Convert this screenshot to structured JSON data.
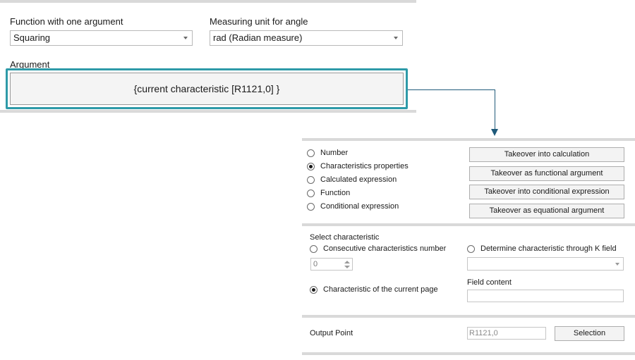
{
  "function_panel": {
    "function_label": "Function with one argument",
    "function_value": "Squaring",
    "angle_unit_label": "Measuring unit for angle",
    "angle_unit_value": "rad (Radian measure)",
    "argument_label": "Argument",
    "argument_value": "{current characteristic [R1121,0] }"
  },
  "colors": {
    "highlight_border": "#2e9aa8",
    "connector_arrow": "#1f5a7a"
  },
  "selector": {
    "options": [
      {
        "label": "Number",
        "selected": false
      },
      {
        "label": "Characteristics properties",
        "selected": true
      },
      {
        "label": "Calculated expression",
        "selected": false
      },
      {
        "label": "Function",
        "selected": false
      },
      {
        "label": "Conditional expression",
        "selected": false
      }
    ],
    "buttons": [
      "Takeover into calculation",
      "Takeover as functional argument",
      "Takeover into conditional expression",
      "Takeover as equational argument"
    ]
  },
  "characteristic": {
    "section_label": "Select characteristic",
    "consecutive_label": "Consecutive characteristics number",
    "consecutive_value": "0",
    "kfield_label": "Determine characteristic through K field",
    "kfield_value": "",
    "current_page_label": "Characteristic of the current page",
    "field_content_label": "Field content",
    "field_content_value": ""
  },
  "output": {
    "label": "Output Point",
    "value": "R1121,0",
    "selection_button": "Selection"
  }
}
